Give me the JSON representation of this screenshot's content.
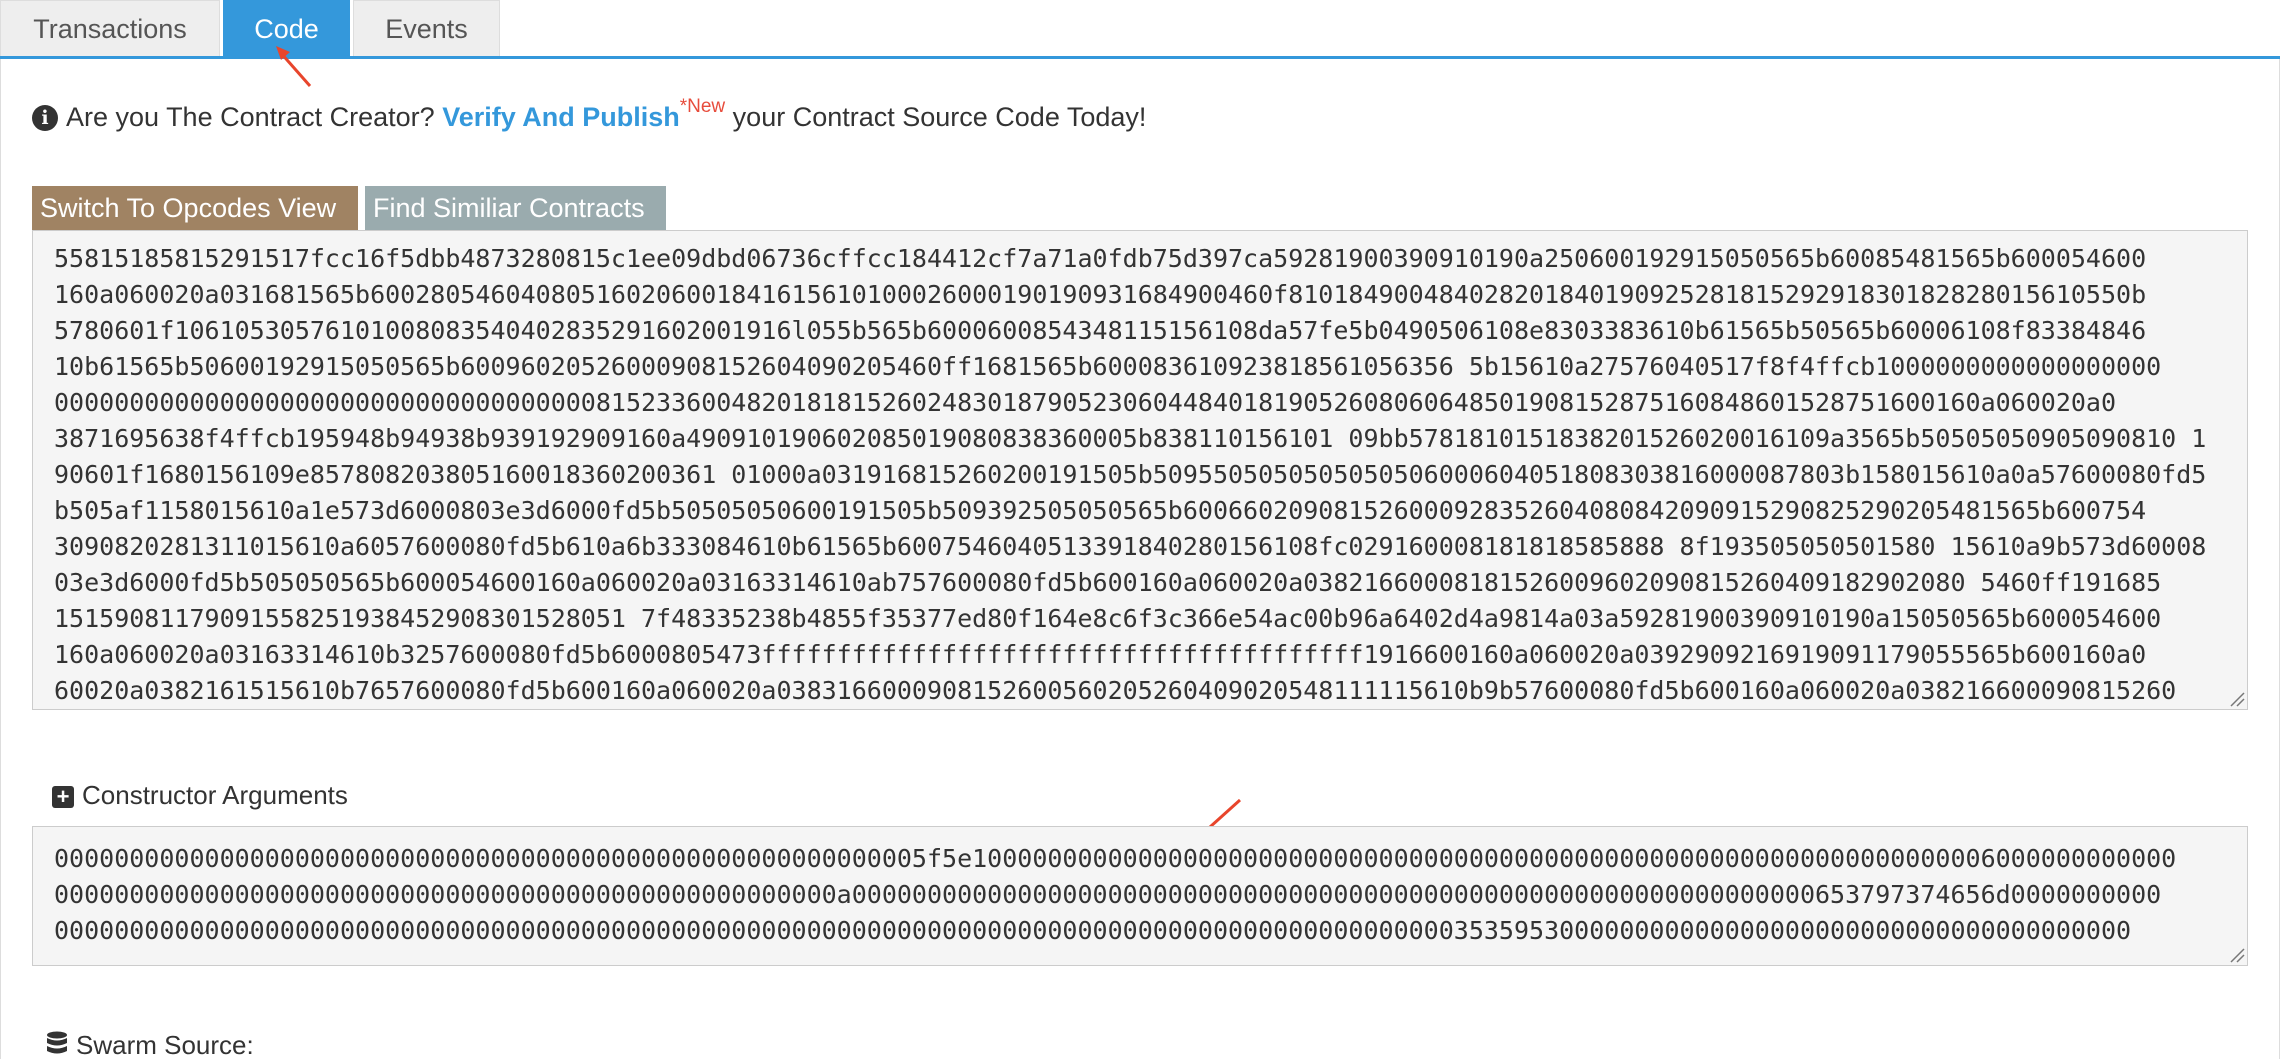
{
  "tabs": [
    {
      "label": "Transactions",
      "active": false
    },
    {
      "label": "Code",
      "active": true
    },
    {
      "label": "Events",
      "active": false
    }
  ],
  "notice": {
    "prefix": "Are you The Contract Creator?",
    "link": "Verify And Publish",
    "badge": "*New",
    "suffix": "your Contract Source Code Today!"
  },
  "buttons": {
    "opcodes": "Switch To Opcodes View",
    "similar": "Find Similiar Contracts"
  },
  "bytecode": "55815185815291517fcc16f5dbb4873280815c1ee09dbd06736cffcc184412cf7a71a0fdb75d397ca59281900390910190a250600192915050565b60085481565b600054600\n160a060020a031681565b600280546040805160206001841615610100026000190190931684900460f81018490048402820184019092528181529291830182828015610550b\n5780601f10610530576101008083540402835291602001916l055b565b6000600854348115156108da57fe5b0490506108e8303383610b61565b50565b60006108f83384846\n10b61565b50600192915050565b60096020526000908152604090205460ff1681565b600083610923818561056356 5b15610a27576040517f8f4ffcb1000000000000000000\n00000000000000000000000000000000000081523360048201818152602483018790523060448401819052608060648501908152875160848601528751600160a060020a0\n3871695638f4ffcb195948b94938b939192909160a490910190602085019080838360005b838110156101 09bb5781810151838201526020016109a3565b50505050905090810 1\n90601f1680156109e857808203805160018360200361 01000a031916815260200191505b5095505050505050506000604051808303816000087803b158015610a0a57600080fd5\nb505af1158015610a1e573d6000803e3d6000fd5b50505050600191505b509392505050565b600660209081526000928352604080842090915290825290205481565b600754\n3090820281311015610a6057600080fd5b610a6b333084610b61565b6007546040513391840280156108fc029160008181818585888 8f193505050501580 15610a9b573d60008\n03e3d6000fd5b505050565b600054600160a060020a03163314610ab757600080fd5b600160a060020a03821660008181526009602090815260409182902080 5460ff191685\n15159081179091558251938452908301528051 7f48335238b4855f35377ed80f164e8c6f3c366e54ac00b96a6402d4a9814a03a59281900390910190a15050565b600054600\n160a060020a03163314610b3257600080fd5b6000805473ffffffffffffffffffffffffffffffffffffffff1916600160a060020a0392909216919091179055565b600160a0\n60020a0382161515610b7657600080fd5b600160a060020a0383166000908152600560205260409020548111115610b9b57600080fd5b600160a060020a038216600090815260",
  "constructor_label": "Constructor Arguments",
  "constructor_args": "0000000000000000000000000000000000000000000000000000000005f5e10000000000000000000000000000000000000000000000000000000000000000006000000000000\n0000000000000000000000000000000000000000000000000000a0000000000000000000000000000000000000000000000000000000000000000653797374656d0000000000\n000000000000000000000000000000000000000000000000000000000000000000000000000000000000000000000353595300000000000000000000000000000000000000",
  "swarm_label": "Swarm Source:",
  "colors": {
    "accent": "#3498db",
    "opcodes_button": "#a08363",
    "similar_button": "#9aabae",
    "badge": "#e74c3c",
    "annotation_arrow": "#e8452c"
  }
}
